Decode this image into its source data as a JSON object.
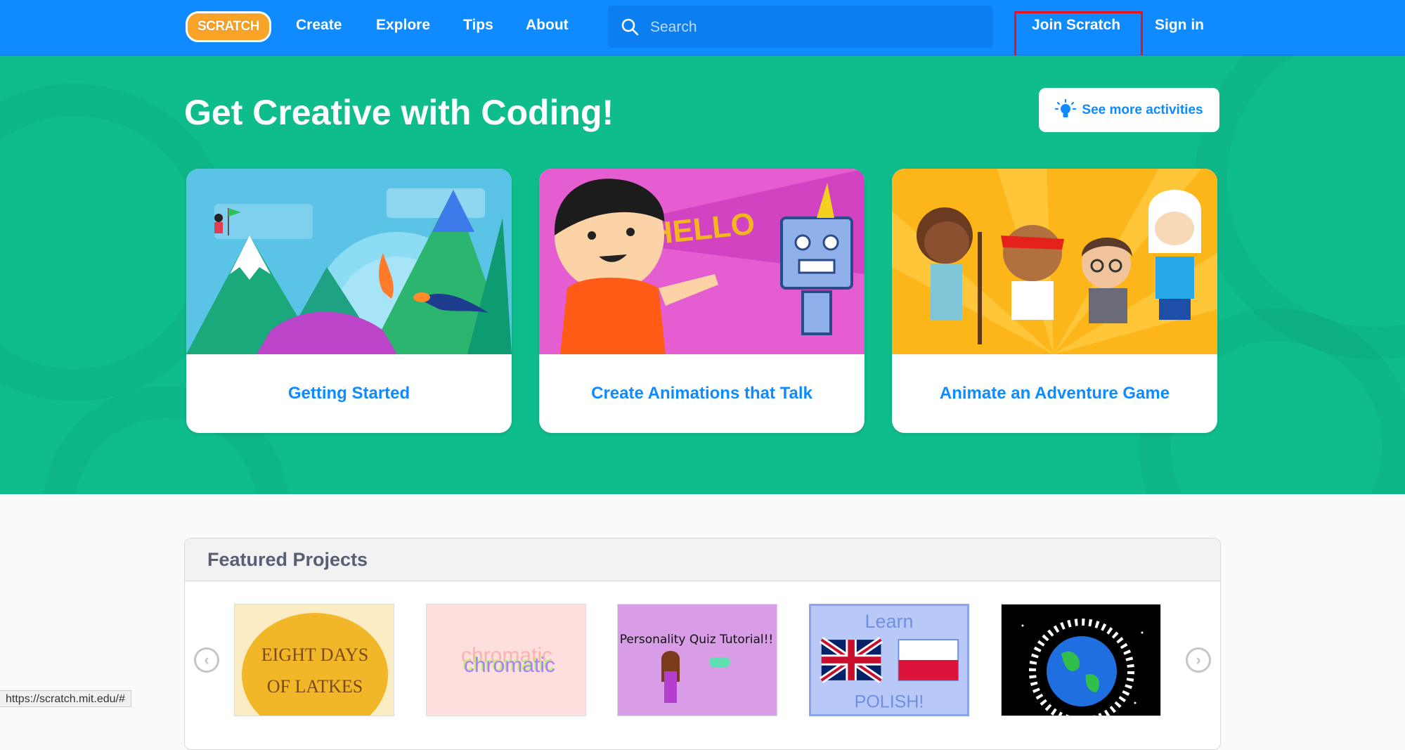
{
  "nav": {
    "logo": "SCRATCH",
    "links": [
      "Create",
      "Explore",
      "Tips",
      "About"
    ],
    "search_placeholder": "Search",
    "join": "Join Scratch",
    "signin": "Sign in",
    "highlight_color": "#e8121e"
  },
  "hero": {
    "title": "Get Creative with Coding!",
    "more_button": "See more activities",
    "cards": [
      {
        "label": "Getting Started"
      },
      {
        "label": "Create Animations that Talk",
        "art_text": "HELLO"
      },
      {
        "label": "Animate an Adventure Game"
      }
    ]
  },
  "featured": {
    "title": "Featured Projects",
    "thumbs": [
      {
        "line1": "EIGHT DAYS",
        "line2": "OF LATKES"
      },
      {
        "text": "chromatic"
      },
      {
        "text": "Personality Quiz Tutorial!!"
      },
      {
        "line1": "Learn",
        "line2": "POLISH!"
      },
      {}
    ]
  },
  "status_url": "https://scratch.mit.edu/#",
  "colors": {
    "nav_blue": "#0f8bff",
    "hero_green": "#0fbd8c",
    "link_blue": "#0f8bff"
  }
}
